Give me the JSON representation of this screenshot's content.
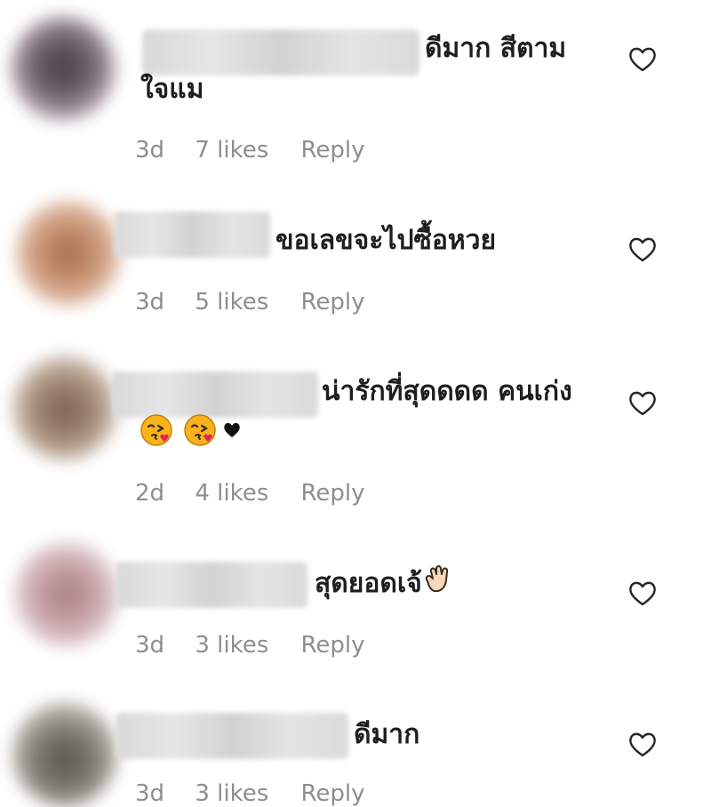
{
  "comments": [
    {
      "text": "ดีมาก สีตาม",
      "text_line2": "ใจแม",
      "time": "3d",
      "likes": "7 likes",
      "reply": "Reply"
    },
    {
      "text": "ขอเลขจะไปซื้อหวย",
      "time": "3d",
      "likes": "5 likes",
      "reply": "Reply"
    },
    {
      "text": "น่ารักที่สุดดดด คนเก่ง",
      "time": "2d",
      "likes": "4 likes",
      "reply": "Reply"
    },
    {
      "text": "สุดยอดเจ้",
      "time": "3d",
      "likes": "3 likes",
      "reply": "Reply"
    },
    {
      "text": "ดีมาก",
      "time": "3d",
      "likes": "3 likes",
      "reply": "Reply"
    }
  ],
  "icons": {
    "like": "heart-outline-icon",
    "kiss_emoji": "face-blowing-kiss-emoji",
    "heart_emoji": "black-heart-emoji",
    "wave_emoji": "waving-hand-emoji"
  },
  "colors": {
    "text": "#1e1e1e",
    "meta": "#8e8e8e"
  }
}
